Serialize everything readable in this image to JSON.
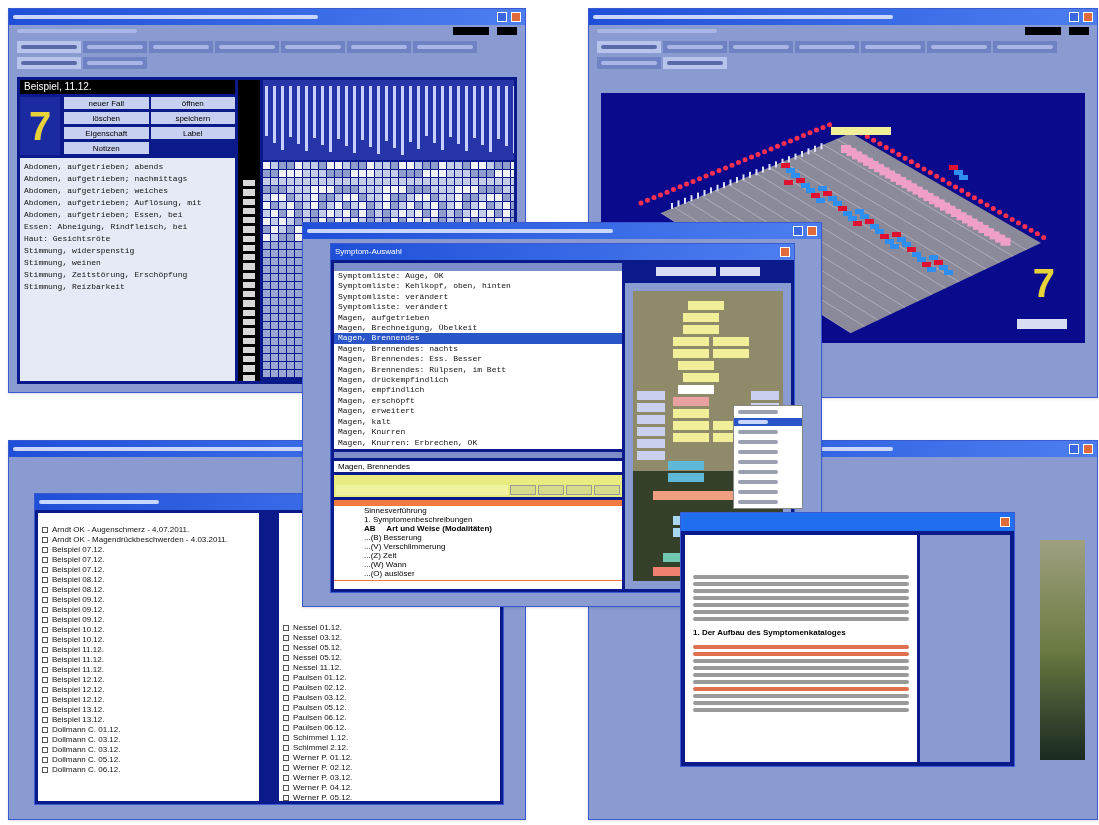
{
  "main_window": {
    "case_name": "Beispiel, 11.12.",
    "logo": "7",
    "buttons": [
      "neuer Fall",
      "öffnen",
      "löschen",
      "speichern",
      "Eigenschaft",
      "Label",
      "Notizen"
    ],
    "tabs": [
      {
        "selected": true
      },
      {
        "selected": false
      },
      {
        "selected": false
      },
      {
        "selected": false
      },
      {
        "selected": false
      },
      {
        "selected": false
      },
      {
        "selected": false
      }
    ],
    "subtabs": [
      {
        "selected": true
      },
      {
        "selected": false
      }
    ],
    "rubrics": [
      "Abdomen, aufgetrieben; abends",
      "Abdomen, aufgetrieben; nachmittags",
      "Abdomen, aufgetrieben; weiches",
      "Abdomen, aufgetrieben; Auflösung, mit",
      "Abdomen, aufgetrieben; Essen, bei",
      "Essen: Abneigung, Rindfleisch, bei",
      "Haut: Gesichtsröte",
      "Stimmung, widerspenstig",
      "Stimmung, weinen",
      "Stimmung, Zeitstörung, Erschöpfung",
      "Stimmung, Reizbarkeit"
    ]
  },
  "chart_window": {
    "logo": "7",
    "tabs": [
      {
        "selected": true
      },
      {
        "selected": false
      },
      {
        "selected": false
      },
      {
        "selected": false
      },
      {
        "selected": false
      },
      {
        "selected": false
      },
      {
        "selected": false
      }
    ],
    "subtabs": [
      {
        "selected": false
      },
      {
        "selected": true
      }
    ]
  },
  "lists_window": {
    "left_items": [
      {
        "text": "Arndt OK - Augenschmerz - 4.07.2011.",
        "checked": false
      },
      {
        "text": "Arndt OK - Magendrückbeschwerden - 4.03.2011.",
        "checked": false
      },
      {
        "text": "Beispiel 07.12.",
        "checked": false
      },
      {
        "text": "Beispiel 07.12.",
        "checked": false
      },
      {
        "text": "Beispiel 07.12.",
        "checked": false
      },
      {
        "text": "Beispiel 08.12.",
        "checked": false
      },
      {
        "text": "Beispiel 08.12.",
        "checked": false
      },
      {
        "text": "Beispiel 09.12.",
        "checked": false
      },
      {
        "text": "Beispiel 09.12.",
        "checked": false
      },
      {
        "text": "Beispiel 09.12.",
        "checked": false
      },
      {
        "text": "Beispiel 10.12.",
        "checked": false
      },
      {
        "text": "Beispiel 10.12.",
        "checked": false
      },
      {
        "text": "Beispiel 11.12.",
        "checked": false
      },
      {
        "text": "Beispiel 11.12.",
        "checked": false
      },
      {
        "text": "Beispiel 11.12.",
        "checked": false
      },
      {
        "text": "Beispiel 12.12.",
        "checked": false
      },
      {
        "text": "Beispiel 12.12.",
        "checked": false
      },
      {
        "text": "Beispiel 12.12.",
        "checked": false
      },
      {
        "text": "Beispiel 13.12.",
        "checked": false
      },
      {
        "text": "Beispiel 13.12.",
        "checked": false
      },
      {
        "text": "Dollmann C. 01.12.",
        "checked": false
      },
      {
        "text": "Dollmann C. 03.12.",
        "checked": false
      },
      {
        "text": "Dollmann C. 03.12.",
        "checked": false
      },
      {
        "text": "Dollmann C. 05.12.",
        "checked": false
      },
      {
        "text": "Dollmann C. 06.12.",
        "checked": false
      }
    ],
    "right_items": [
      {
        "text": "Nessel 01.12.",
        "checked": false
      },
      {
        "text": "Nessel 03.12.",
        "checked": false
      },
      {
        "text": "Nessel 05.12.",
        "checked": false
      },
      {
        "text": "Nessel 05.12.",
        "checked": false
      },
      {
        "text": "Nessel 11.12.",
        "checked": false
      },
      {
        "text": "Paulsen 01.12.",
        "checked": false
      },
      {
        "text": "Paulsen 02.12.",
        "checked": false
      },
      {
        "text": "Paulsen 03.12.",
        "checked": false
      },
      {
        "text": "Paulsen 05.12.",
        "checked": false
      },
      {
        "text": "Paulsen 06.12.",
        "checked": false
      },
      {
        "text": "Paulsen 06.12.",
        "checked": false
      },
      {
        "text": "Schimmel 1.12.",
        "checked": false
      },
      {
        "text": "Schimmel 2.12.",
        "checked": false
      },
      {
        "text": "Werner P. 01.12.",
        "checked": false
      },
      {
        "text": "Werner P. 02.12.",
        "checked": false
      },
      {
        "text": "Werner P. 03.12.",
        "checked": false
      },
      {
        "text": "Werner P. 04.12.",
        "checked": false
      },
      {
        "text": "Werner P. 05.12.",
        "checked": false
      }
    ]
  },
  "symptom_dialog": {
    "title": "Symptom-Auswahl",
    "rows": [
      {
        "text": "Symptomliste: Auge, OK",
        "selected": false
      },
      {
        "text": "Symptomliste: Kehlkopf, oben, hinten",
        "selected": false
      },
      {
        "text": "Symptomliste: verändert",
        "selected": false
      },
      {
        "text": "Symptomliste: verändert",
        "selected": false
      },
      {
        "text": "Magen, aufgetrieben",
        "selected": false
      },
      {
        "text": "Magen, Brechneigung, Übelkeit",
        "selected": false
      },
      {
        "text": "Magen, Brennendes",
        "selected": true
      },
      {
        "text": "Magen, Brennendes: nachts",
        "selected": false
      },
      {
        "text": "Magen, Brennendes: Ess. Besser",
        "selected": false
      },
      {
        "text": "Magen, Brennendes: Rülpsen, im Bett",
        "selected": false
      },
      {
        "text": "Magen, drückempfindlich",
        "selected": false
      },
      {
        "text": "Magen, empfindlich",
        "selected": false
      },
      {
        "text": "Magen, erschöpft",
        "selected": false
      },
      {
        "text": "Magen, erweitert",
        "selected": false
      },
      {
        "text": "Magen, kalt",
        "selected": false
      },
      {
        "text": "Magen, Knurren",
        "selected": false
      },
      {
        "text": "Magen, Knurren: Erbrechen, OK",
        "selected": false
      }
    ],
    "entry_value": "Magen, Brennendes",
    "notes": [
      {
        "text": "Sinnesverführung",
        "bold": false
      },
      {
        "text": "1. Symptomenbeschreibungen",
        "bold": false
      },
      {
        "text": "AB     Art und Weise (Modalitäten)",
        "bold": true
      },
      {
        "text": "...(B) Besserung",
        "bold": false
      },
      {
        "text": "...(V) Verschlimmerung",
        "bold": false
      },
      {
        "text": "...(Z) Zeit",
        "bold": false
      },
      {
        "text": "...(W) Wann",
        "bold": false
      },
      {
        "text": "...(O) auslöser",
        "bold": false
      }
    ],
    "menu": [
      {
        "selected": false
      },
      {
        "selected": true
      },
      {
        "selected": false
      },
      {
        "selected": false
      },
      {
        "selected": false
      },
      {
        "selected": false
      },
      {
        "selected": false
      },
      {
        "selected": false
      },
      {
        "selected": false
      },
      {
        "selected": false
      }
    ]
  },
  "help_dialog": {
    "heading": "1. Der Aufbau des Symptomenkataloges"
  }
}
